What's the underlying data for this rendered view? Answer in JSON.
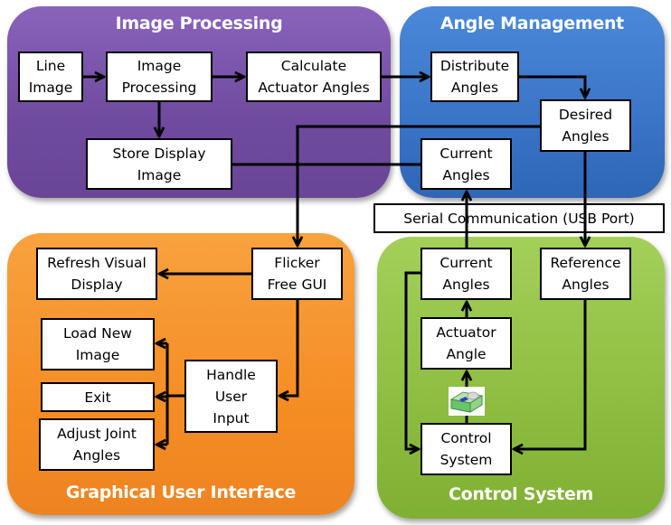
{
  "panels": {
    "image_processing": {
      "title": "Image Processing",
      "color": "#7b55aa"
    },
    "angle_management": {
      "title": "Angle Management",
      "color": "#3b78c8"
    },
    "gui": {
      "title": "Graphical User Interface",
      "color": "#f59028"
    },
    "control_system": {
      "title": "Control System",
      "color": "#8dbd40"
    }
  },
  "boxes": {
    "line_image": "Line\nImage",
    "image_processing": "Image\nProcessing",
    "calculate_actuator_angles": "Calculate\nActuator Angles",
    "store_display_image": "Store Display\nImage",
    "distribute_angles": "Distribute\nAngles",
    "desired_angles": "Desired\nAngles",
    "current_angles_am": "Current\nAngles",
    "serial_communication": "Serial Communication (USB Port)",
    "refresh_visual_display": "Refresh Visual\nDisplay",
    "flicker_free_gui": "Flicker\nFree GUI",
    "load_new_image": "Load New\nImage",
    "exit": "Exit",
    "handle_user_input": "Handle\nUser\nInput",
    "adjust_joint_angles": "Adjust Joint\nAngles",
    "current_angles_cs": "Current\nAngles",
    "reference_angles": "Reference\nAngles",
    "actuator_angle": "Actuator\nAngle",
    "control_system": "Control\nSystem"
  },
  "icons": {
    "servo": "servo-motor-icon"
  }
}
